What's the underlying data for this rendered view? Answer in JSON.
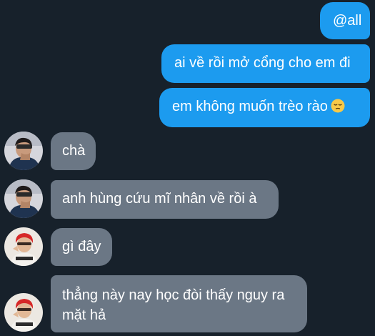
{
  "conversation": {
    "outgoing": [
      {
        "text": "@all"
      },
      {
        "text": "ai về rồi mở cổng cho em đi"
      },
      {
        "text": "em không muốn trèo rào",
        "emoji": "pensive-face-icon"
      }
    ],
    "incoming": [
      {
        "text": "chà",
        "sender_avatar": "avatar-1"
      },
      {
        "text": "anh hùng cứu mĩ nhân về rồi à",
        "sender_avatar": "avatar-1"
      },
      {
        "text": "gì đây",
        "sender_avatar": "avatar-2"
      },
      {
        "text": "thẳng này nay học đòi thấy nguy ra mặt hả",
        "sender_avatar": "avatar-2"
      }
    ]
  },
  "colors": {
    "background": "#17212b",
    "outgoing_bubble": "#1c9bef",
    "incoming_bubble": "#6b7785",
    "text": "#ffffff"
  }
}
